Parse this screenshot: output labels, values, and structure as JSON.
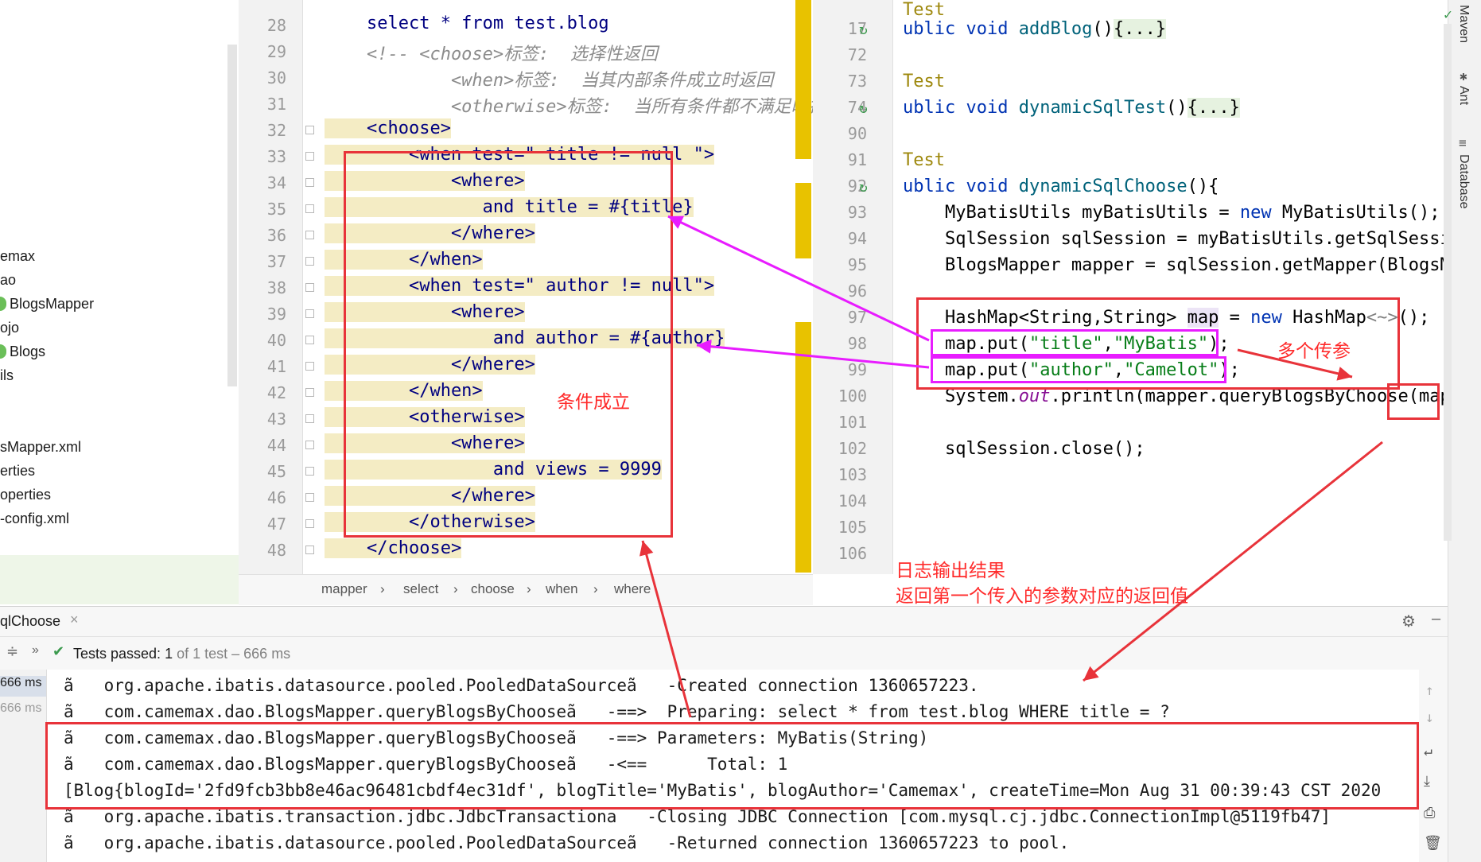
{
  "project_tree": {
    "items": [
      "emax",
      "ao",
      "BlogsMapper",
      "ojo",
      "Blogs",
      "ils",
      "sMapper.xml",
      "erties",
      "operties",
      "-config.xml"
    ]
  },
  "xml_editor": {
    "lines": [
      {
        "n": "28",
        "text": "    select * from test.blog"
      },
      {
        "n": "29",
        "text": "    <!-- <choose>标签:  选择性返回"
      },
      {
        "n": "30",
        "text": "            <when>标签:  当其内部条件成立时返回"
      },
      {
        "n": "31",
        "text": "            <otherwise>标签:  当所有条件都不满足时执行-"
      },
      {
        "n": "32",
        "text": "    <choose>"
      },
      {
        "n": "33",
        "text": "        <when test=\" title != null \">"
      },
      {
        "n": "34",
        "text": "            <where>"
      },
      {
        "n": "35",
        "text": "               and title = #{title}"
      },
      {
        "n": "36",
        "text": "            </where>"
      },
      {
        "n": "37",
        "text": "        </when>"
      },
      {
        "n": "38",
        "text": "        <when test=\" author != null\">"
      },
      {
        "n": "39",
        "text": "            <where>"
      },
      {
        "n": "40",
        "text": "                and author = #{author}"
      },
      {
        "n": "41",
        "text": "            </where>"
      },
      {
        "n": "42",
        "text": "        </when>"
      },
      {
        "n": "43",
        "text": "        <otherwise>"
      },
      {
        "n": "44",
        "text": "            <where>"
      },
      {
        "n": "45",
        "text": "                and views = 9999"
      },
      {
        "n": "46",
        "text": "            </where>"
      },
      {
        "n": "47",
        "text": "        </otherwise>"
      },
      {
        "n": "48",
        "text": "    </choose>"
      }
    ],
    "breadcrumb": [
      "mapper",
      "select",
      "choose",
      "when",
      "where"
    ]
  },
  "java_editor": {
    "line_numbers": [
      "17",
      "72",
      "73",
      "74",
      "90",
      "91",
      "92",
      "93",
      "94",
      "95",
      "96",
      "97",
      "98",
      "99",
      "100",
      "101",
      "102",
      "103",
      "104",
      "105",
      "106"
    ],
    "code": {
      "l17": "ublic void addBlog(){...}",
      "l73": "Test",
      "l74": "ublic void dynamicSqlTest(){...}",
      "l91": "Test",
      "l92": "ublic void dynamicSqlChoose(){",
      "l93": "    MyBatisUtils myBatisUtils = new MyBatisUtils();",
      "l94": "    SqlSession sqlSession = myBatisUtils.getSqlSession(",
      "l95": "    BlogsMapper mapper = sqlSession.getMapper(BlogsMapp",
      "l97": "    HashMap<String,String> map = new HashMap<~>();",
      "l98": "    map.put(\"title\",\"MyBatis\");",
      "l99": "    map.put(\"author\",\"Camelot\");",
      "l100": "    System.out.println(mapper.queryBlogsByChoose(map));",
      "l102": "    sqlSession.close();"
    }
  },
  "right_tools": [
    "Maven",
    "Ant",
    "Database"
  ],
  "run_panel": {
    "tab_label": "qlChoose",
    "status": "Tests passed:",
    "status_count": "1",
    "status_rest": "of 1 test – 666 ms",
    "left_times": [
      "666 ms",
      "666 ms"
    ],
    "console_lines": [
      "ã   org.apache.ibatis.datasource.pooled.PooledDataSourceã   -Created connection 1360657223.",
      "ã   com.camemax.dao.BlogsMapper.queryBlogsByChooseã   -==>  Preparing: select * from test.blog WHERE title = ?",
      "ã   com.camemax.dao.BlogsMapper.queryBlogsByChooseã   -==> Parameters: MyBatis(String)",
      "ã   com.camemax.dao.BlogsMapper.queryBlogsByChooseã   -<==      Total: 1",
      "[Blog{blogId='2fd9fcb3bb8e46ac96481cbdf4ec31df', blogTitle='MyBatis', blogAuthor='Camemax', createTime=Mon Aug 31 00:39:43 CST 2020",
      "ã   org.apache.ibatis.transaction.jdbc.JdbcTransactiona   -Closing JDBC Connection [com.mysql.cj.jdbc.ConnectionImpl@5119fb47]",
      "ã   org.apache.ibatis.datasource.pooled.PooledDataSourceã   -Returned connection 1360657223 to pool."
    ]
  },
  "annotations": {
    "condition_met": "条件成立",
    "multi_params": "多个传参",
    "log_title": "日志输出结果",
    "log_desc": "返回第一个传入的参数对应的返回值"
  },
  "colors": {
    "annotation_red": "#e8333a",
    "annotation_magenta": "#e81cff"
  }
}
